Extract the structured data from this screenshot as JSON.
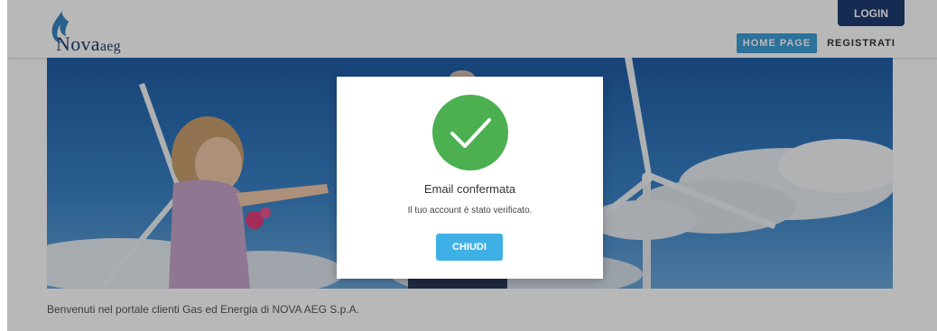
{
  "header": {
    "logo": {
      "brand": "Nova",
      "suffix": "aeg",
      "icon": "flame-icon"
    },
    "login_label": "LOGIN",
    "nav": {
      "home_label": "HOME PAGE",
      "register_label": "REGISTRATI"
    }
  },
  "hero": {
    "image": "child-with-wind-turbines"
  },
  "main": {
    "welcome_text": "Benvenuti nel portale clienti Gas ed Energia di NOVA AEG S.p.A."
  },
  "modal": {
    "icon": "check-circle-icon",
    "title": "Email confermata",
    "message": "Il tuo account è stato verificato.",
    "close_label": "CHIUDI"
  },
  "colors": {
    "brand_navy": "#1f3c71",
    "nav_active": "#3e9fd6",
    "success_green": "#4caf50",
    "button_blue": "#3fb0e6"
  }
}
